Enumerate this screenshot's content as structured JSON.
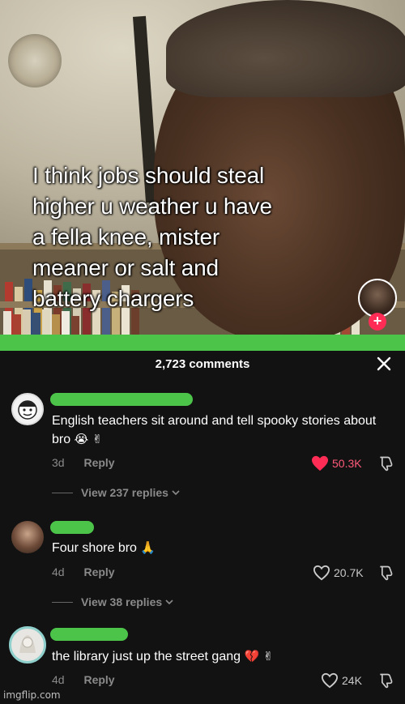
{
  "video": {
    "caption_lines": [
      "I think jobs should steal",
      "higher u weather u have",
      "a fella knee, mister",
      "meaner or salt and",
      "battery chargers"
    ],
    "follow_symbol": "+"
  },
  "comments_sheet": {
    "count_label": "2,723 comments",
    "close_icon": "close-icon"
  },
  "comments": [
    {
      "text": "English teachers sit around and tell spooky stories about bro",
      "emoji": "😭 ✌",
      "age": "3d",
      "reply_label": "Reply",
      "likes": "50.3K",
      "liked": true,
      "view_replies": "View 237 replies"
    },
    {
      "text": "Four shore bro",
      "emoji": "🙏",
      "age": "4d",
      "reply_label": "Reply",
      "likes": "20.7K",
      "liked": false,
      "view_replies": "View 38 replies"
    },
    {
      "text": "the library just up the street gang",
      "emoji": "💔 ✌",
      "age": "4d",
      "reply_label": "Reply",
      "likes": "24K",
      "liked": false
    }
  ],
  "colors": {
    "like_active": "#ff2d55",
    "redaction_green": "#4cc44a",
    "sheet_bg": "#121212"
  },
  "watermark": "imgflip.com"
}
